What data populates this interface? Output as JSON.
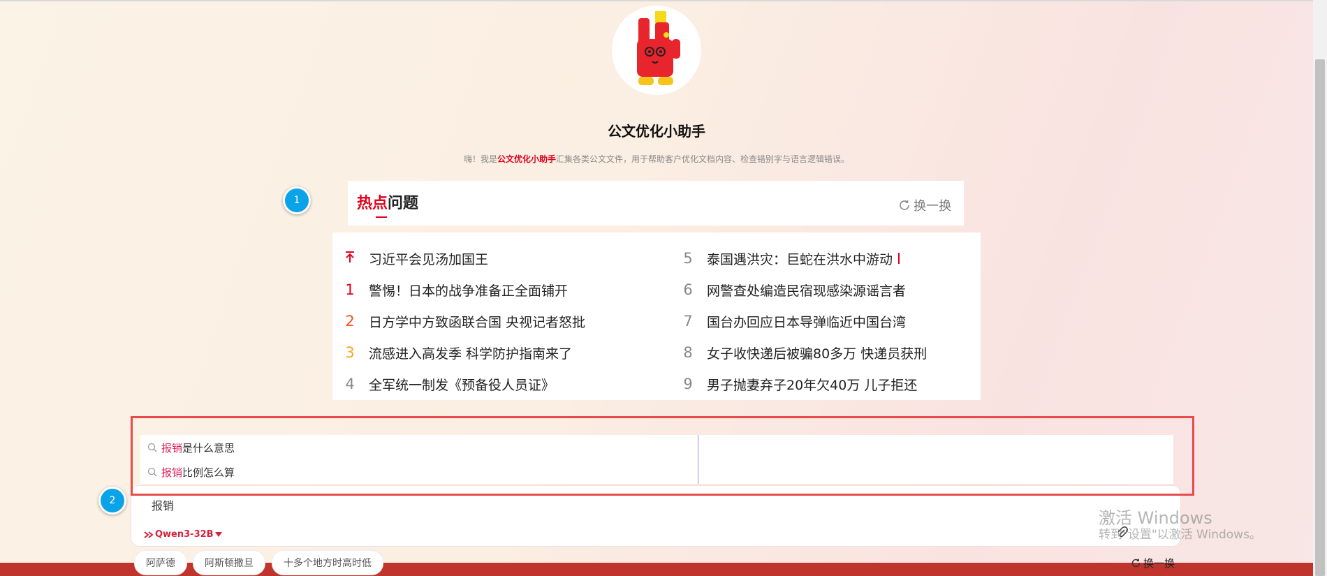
{
  "app": {
    "title": "公文优化小助手"
  },
  "intro": {
    "prefix": "嗨！我是",
    "highlight": "公文优化小助手",
    "suffix": "汇集各类公文文件，用于帮助客户优化文档内容、检查错别字与语言逻辑错误。"
  },
  "hot": {
    "title_red": "热点",
    "title_rest": "问题",
    "refresh_label": "换一换",
    "left": [
      {
        "rank": "↑",
        "text": "习近平会见汤加国王",
        "pinned": true
      },
      {
        "rank": "1",
        "text": "警惕！日本的战争准备正全面铺开"
      },
      {
        "rank": "2",
        "text": "日方学中方致函联合国 央视记者怒批"
      },
      {
        "rank": "3",
        "text": "流感进入高发季 科学防护指南来了"
      },
      {
        "rank": "4",
        "text": "全军统一制发《预备役人员证》"
      }
    ],
    "right": [
      {
        "rank": "5",
        "text": "泰国遇洪灾：巨蛇在洪水中游动"
      },
      {
        "rank": "6",
        "text": "网警查处编造民宿现感染源谣言者"
      },
      {
        "rank": "7",
        "text": "国台办回应日本导弹临近中国台湾"
      },
      {
        "rank": "8",
        "text": "女子收快递后被骗80多万 快递员获刑"
      },
      {
        "rank": "9",
        "text": "男子抛妻弃子20年欠40万 儿子拒还"
      }
    ]
  },
  "suggestions": [
    {
      "keyword": "报销",
      "rest": "是什么意思"
    },
    {
      "keyword": "报销",
      "rest": "比例怎么算"
    }
  ],
  "input": {
    "value": "报销",
    "model_label": "Qwen3-32B"
  },
  "chips": [
    "阿萨德",
    "阿斯顿撒旦",
    "十多个地方时高时低"
  ],
  "chips_refresh_label": "换一换",
  "annotations": {
    "badge1": "1",
    "badge2": "2"
  },
  "watermark": {
    "line1": "激活 Windows",
    "line2": "转到\"设置\"以激活 Windows。"
  },
  "colors": {
    "accent": "#e0001b",
    "highlight_box": "#e94a4a",
    "badge": "#0aa3e8"
  }
}
